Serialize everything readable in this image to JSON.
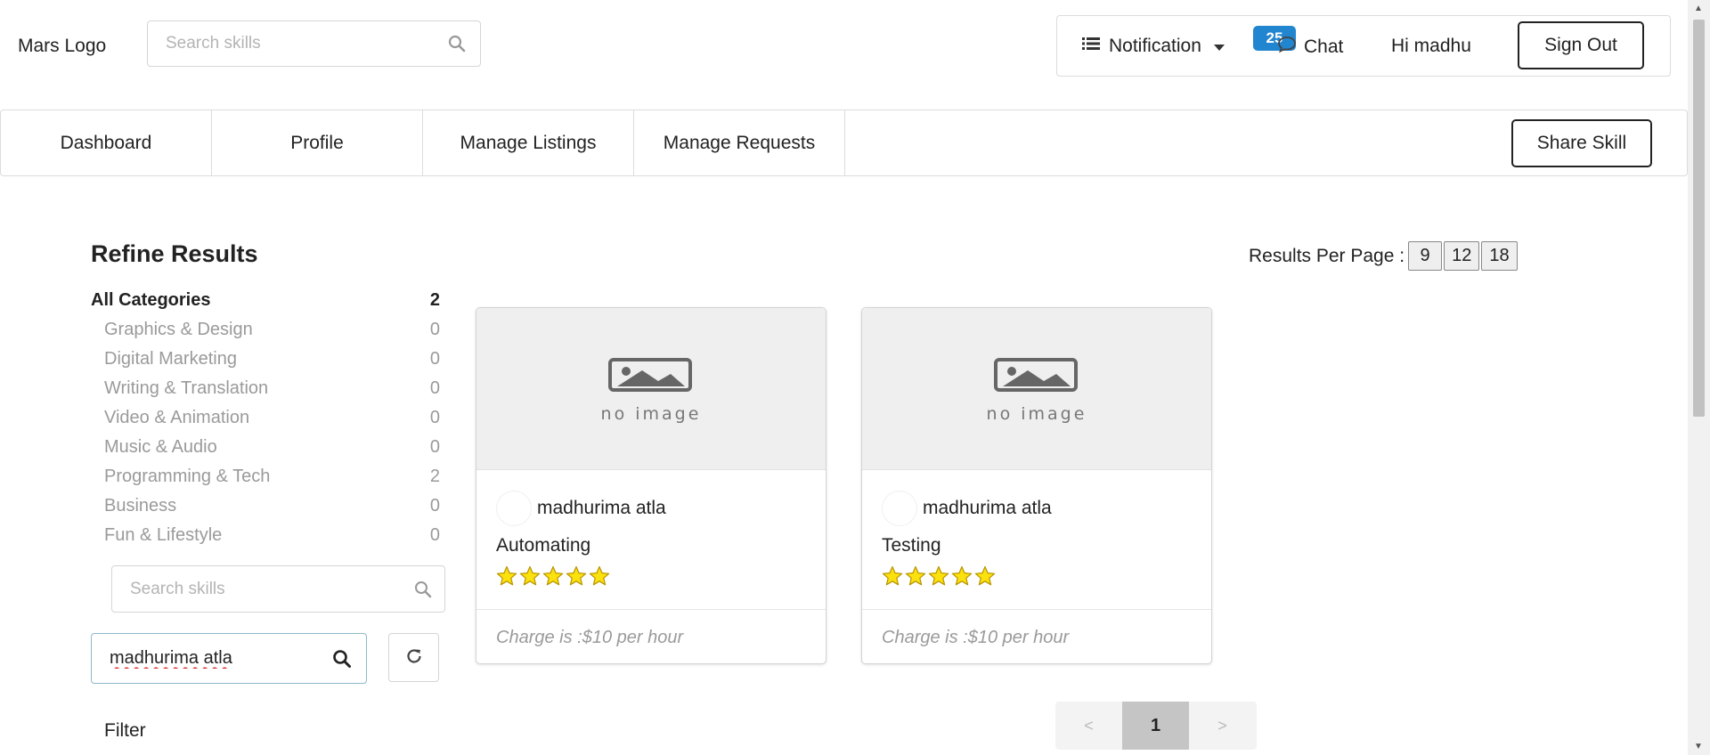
{
  "header": {
    "logo": "Mars Logo",
    "search_placeholder": "Search skills",
    "notification_label": "Notification",
    "notification_count": "25",
    "chat_label": "Chat",
    "greeting": "Hi madhu",
    "signout_label": "Sign Out"
  },
  "tabs": {
    "dashboard": "Dashboard",
    "profile": "Profile",
    "manage_listings": "Manage Listings",
    "manage_requests": "Manage Requests",
    "share_skill": "Share Skill"
  },
  "refine": {
    "title": "Refine Results",
    "all": {
      "label": "All Categories",
      "count": "2"
    },
    "categories": [
      {
        "label": "Graphics & Design",
        "count": "0"
      },
      {
        "label": "Digital Marketing",
        "count": "0"
      },
      {
        "label": "Writing & Translation",
        "count": "0"
      },
      {
        "label": "Video & Animation",
        "count": "0"
      },
      {
        "label": "Music & Audio",
        "count": "0"
      },
      {
        "label": "Programming & Tech",
        "count": "2"
      },
      {
        "label": "Business",
        "count": "0"
      },
      {
        "label": "Fun & Lifestyle",
        "count": "0"
      }
    ],
    "skill_search_placeholder": "Search skills",
    "user_search_value": "madhurima atla",
    "filter_label": "Filter"
  },
  "results_per_page": {
    "label": "Results Per Page :",
    "options": [
      "9",
      "12",
      "18"
    ]
  },
  "cards": [
    {
      "image_text": "no image",
      "seller": "madhurima atla",
      "title": "Automating",
      "rating": 5,
      "charge": "Charge is :$10 per hour"
    },
    {
      "image_text": "no image",
      "seller": "madhurima atla",
      "title": "Testing",
      "rating": 5,
      "charge": "Charge is :$10 per hour"
    }
  ],
  "pagination": {
    "prev": "<",
    "current": "1",
    "next": ">"
  },
  "colors": {
    "badge": "#2185d0",
    "star": "#fbe10d",
    "muted_text": "#9a9a9a"
  }
}
